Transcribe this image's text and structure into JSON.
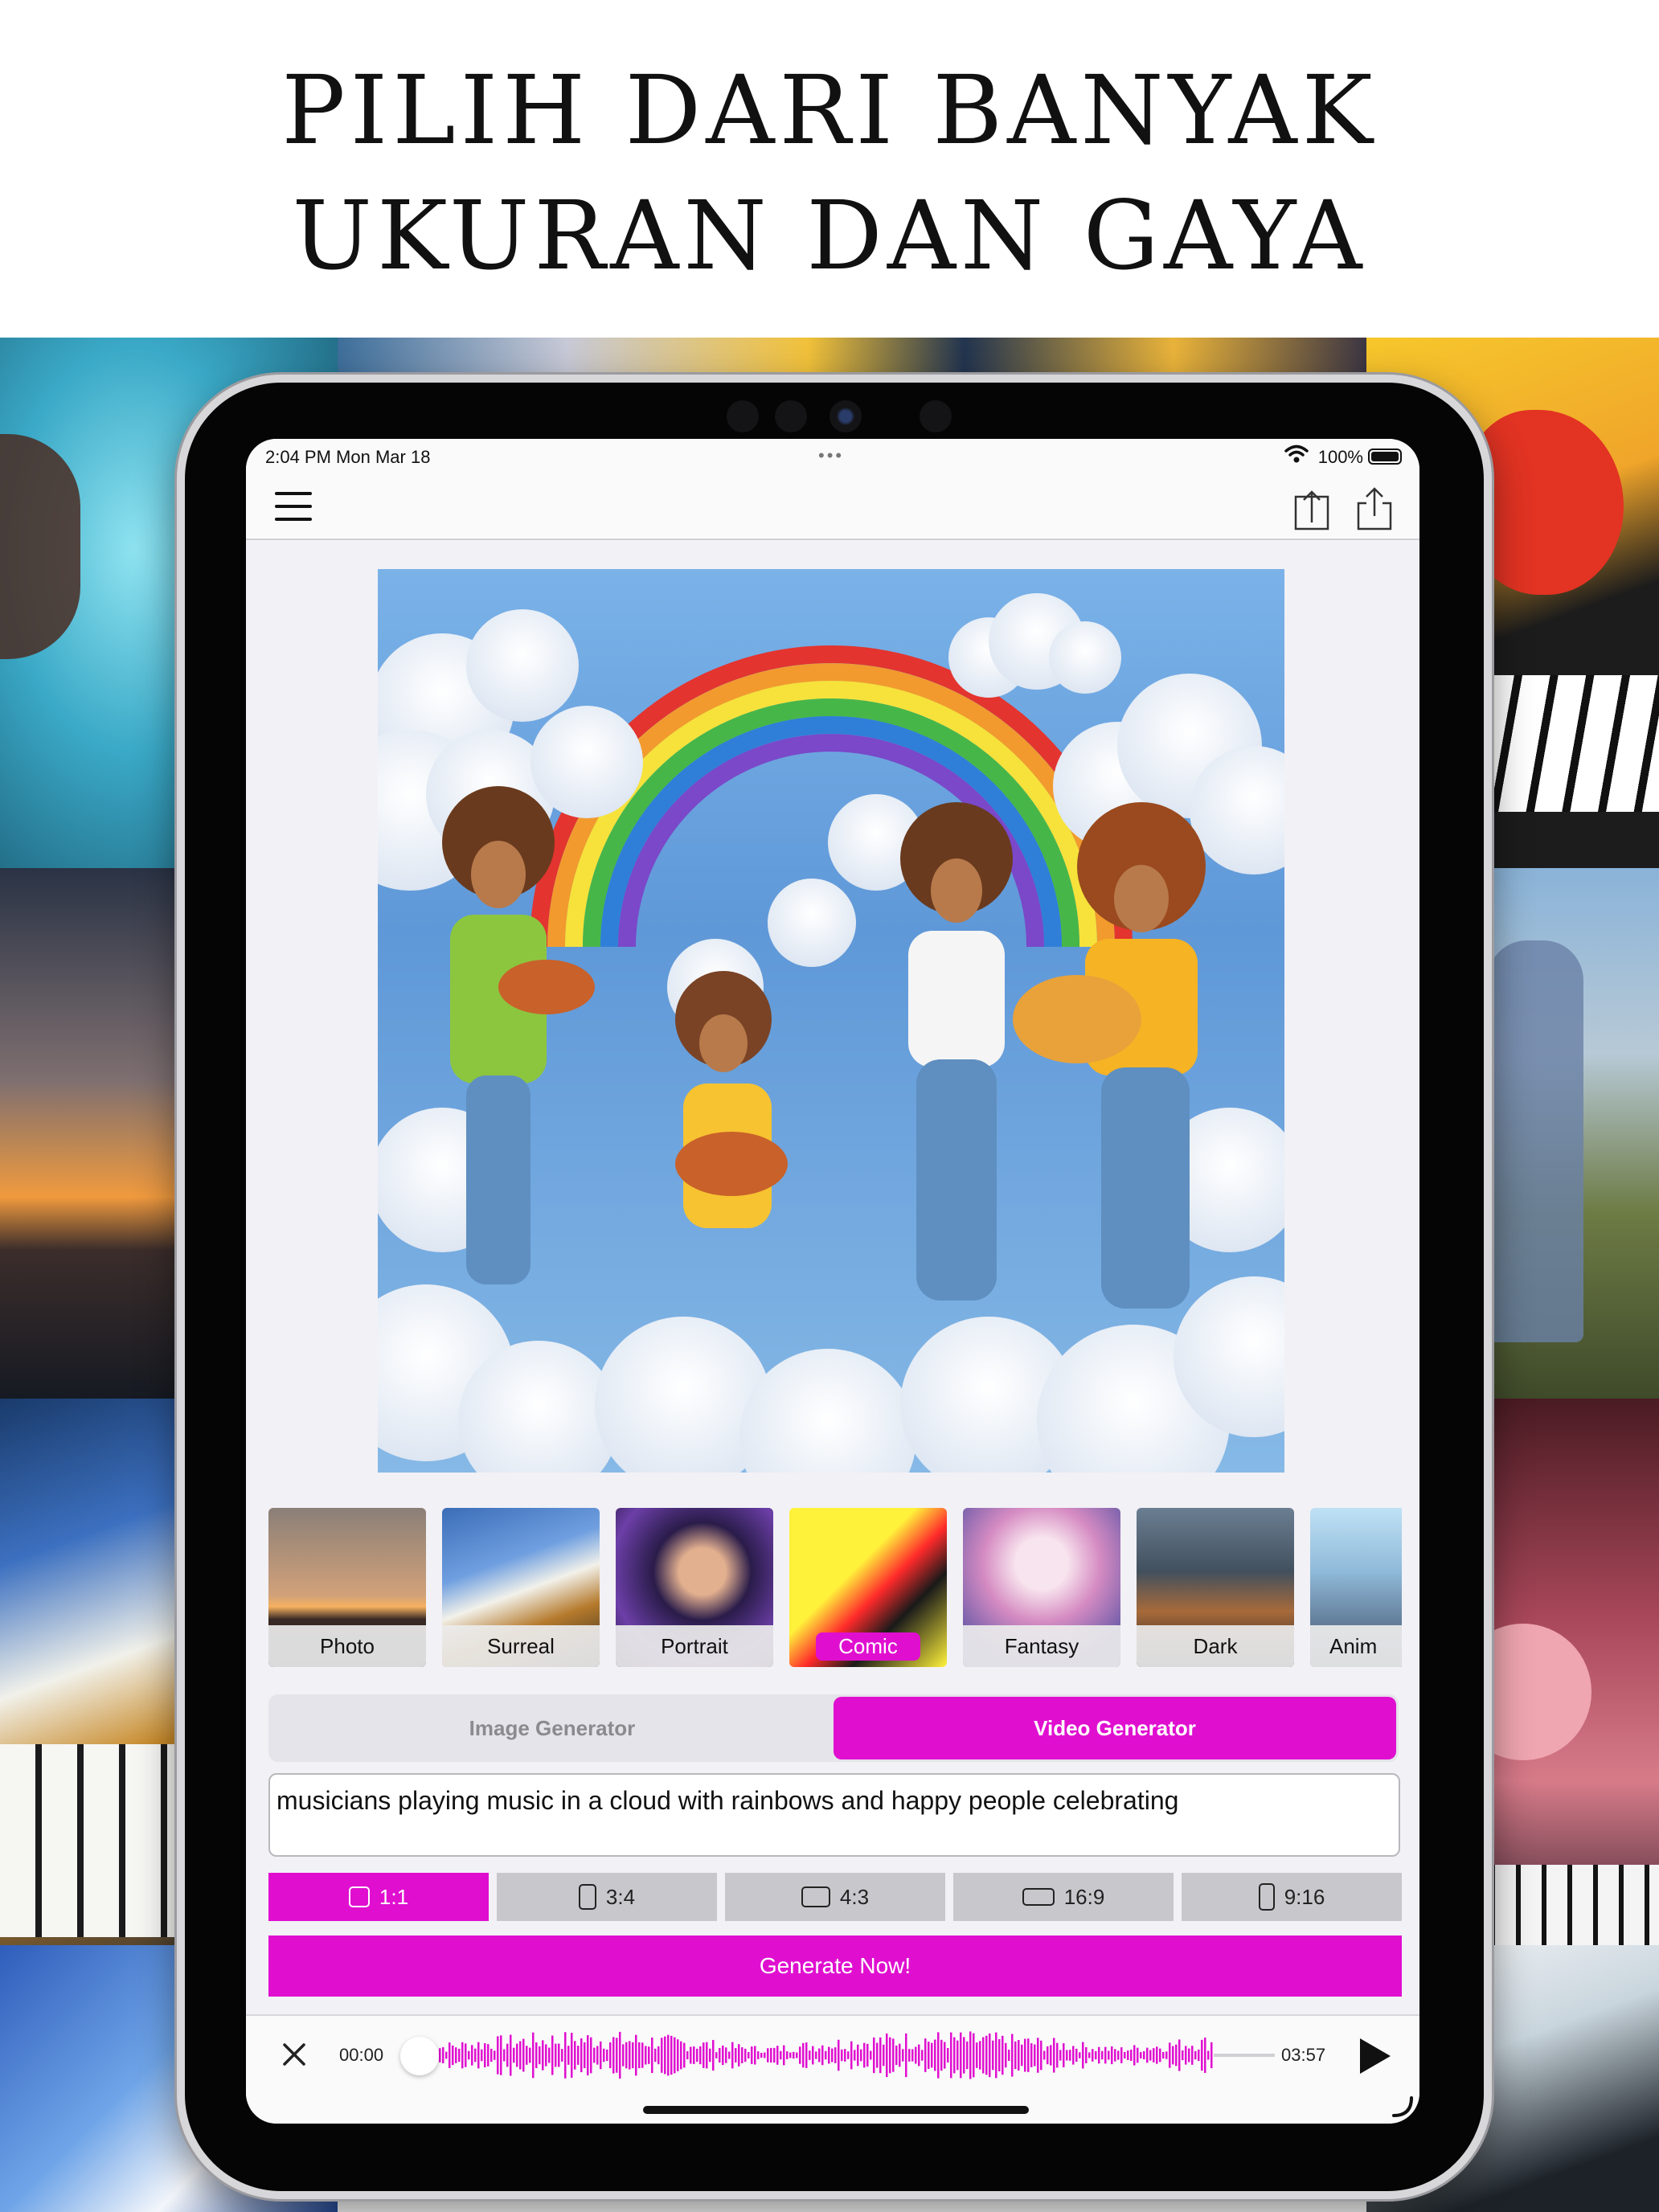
{
  "headline": {
    "line1": "PILIH DARI BANYAK",
    "line2": "UKURAN DAN GAYA"
  },
  "status_bar": {
    "time": "2:04 PM   Mon Mar 18",
    "dots": "•••",
    "battery": "100%"
  },
  "styles": [
    {
      "label": "Photo",
      "active": false
    },
    {
      "label": "Surreal",
      "active": false
    },
    {
      "label": "Portrait",
      "active": false
    },
    {
      "label": "Comic",
      "active": true
    },
    {
      "label": "Fantasy",
      "active": false
    },
    {
      "label": "Dark",
      "active": false
    },
    {
      "label": "Anim",
      "active": false
    }
  ],
  "tabs": {
    "image": "Image Generator",
    "video": "Video Generator",
    "active": "video"
  },
  "prompt": {
    "value": "musicians playing music in a cloud with rainbows and happy people celebrating"
  },
  "aspects": [
    {
      "label": "1:1",
      "active": true
    },
    {
      "label": "3:4",
      "active": false
    },
    {
      "label": "4:3",
      "active": false
    },
    {
      "label": "16:9",
      "active": false
    },
    {
      "label": "9:16",
      "active": false
    }
  ],
  "generate_label": "Generate Now!",
  "player": {
    "start": "00:00",
    "end": "03:57",
    "progress": 0.0
  },
  "colors": {
    "accent": "#e00fd0",
    "segment_bg": "#e5e4ea",
    "aspect_bg": "#c8c8cc"
  },
  "icons": {
    "menu": "hamburger-icon",
    "export": "export-icon",
    "share": "share-icon",
    "close": "close-icon",
    "play": "play-icon"
  }
}
